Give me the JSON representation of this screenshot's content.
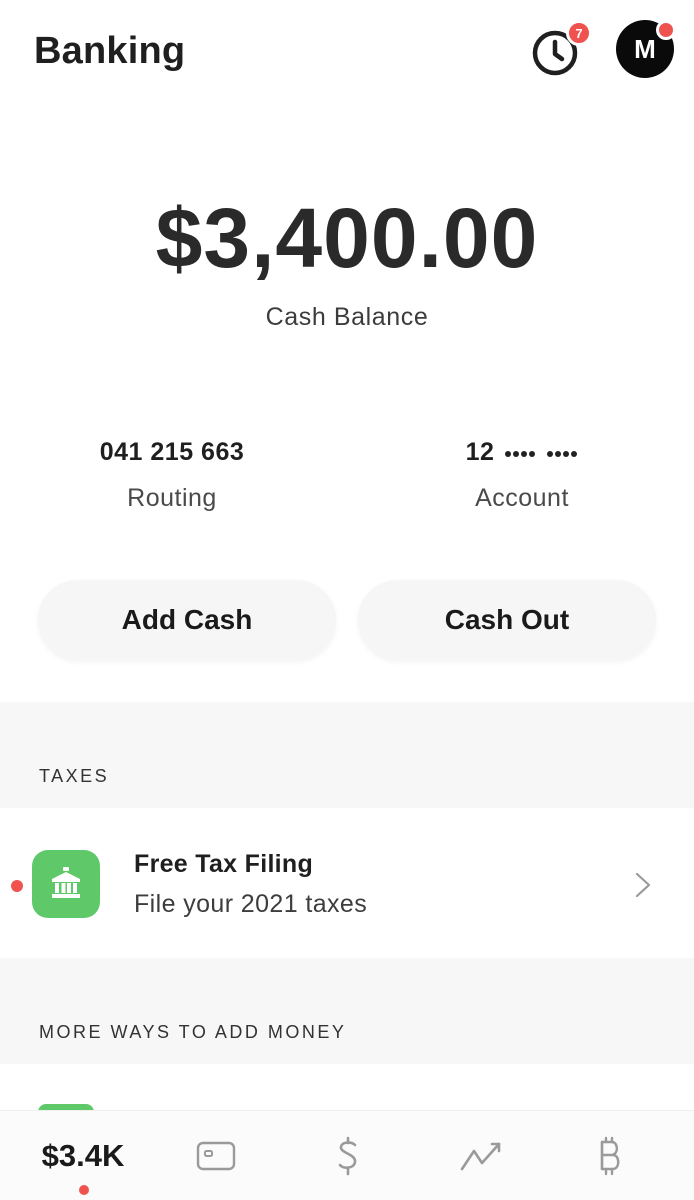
{
  "header": {
    "title": "Banking",
    "activity_badge_count": "7",
    "avatar_initial": "M"
  },
  "balance": {
    "amount": "$3,400.00",
    "label": "Cash Balance"
  },
  "routing": {
    "value": "041 215 663",
    "label": "Routing"
  },
  "account": {
    "value_prefix": "12",
    "label": "Account"
  },
  "actions": {
    "add_cash": "Add Cash",
    "cash_out": "Cash Out"
  },
  "taxes": {
    "section_label": "TAXES",
    "title": "Free Tax Filing",
    "subtitle": "File your 2021 taxes"
  },
  "more_ways": {
    "section_label": "MORE WAYS TO ADD MONEY"
  },
  "bottom_nav": {
    "balance_label": "$3.4K"
  },
  "colors": {
    "badge_red": "#f0524f",
    "tax_green": "#5fc96a"
  },
  "icons": [
    "clock-icon",
    "bank-icon",
    "chevron-right-icon",
    "card-icon",
    "dollar-icon",
    "investing-icon",
    "bitcoin-icon"
  ]
}
